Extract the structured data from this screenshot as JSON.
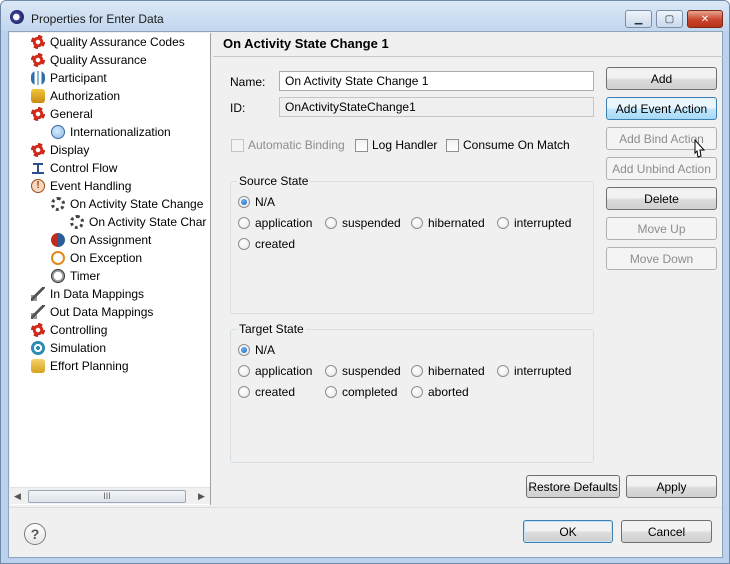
{
  "window": {
    "title": "Properties for Enter Data",
    "minimize_glyph": "▁",
    "maximize_glyph": "▢",
    "close_glyph": "✕"
  },
  "tree": {
    "items": [
      {
        "label": "Quality Assurance Codes",
        "icon": "gear-icon"
      },
      {
        "label": "Quality Assurance",
        "icon": "gear-icon"
      },
      {
        "label": "Participant",
        "icon": "participant-icon"
      },
      {
        "label": "Authorization",
        "icon": "lock-icon"
      },
      {
        "label": "General",
        "icon": "gear-icon"
      },
      {
        "label": "Internationalization",
        "icon": "globe-icon"
      },
      {
        "label": "Display",
        "icon": "gear-icon"
      },
      {
        "label": "Control Flow",
        "icon": "control-flow-icon"
      },
      {
        "label": "Event Handling",
        "icon": "event-warning-icon"
      },
      {
        "label": "On Activity State Change",
        "icon": "cycle-icon"
      },
      {
        "label": "On Activity State Char",
        "icon": "cycle-icon"
      },
      {
        "label": "On Assignment",
        "icon": "assignment-icon"
      },
      {
        "label": "On Exception",
        "icon": "exception-icon"
      },
      {
        "label": "Timer",
        "icon": "timer-icon"
      },
      {
        "label": "In Data Mappings",
        "icon": "data-mapping-icon"
      },
      {
        "label": "Out Data Mappings",
        "icon": "data-mapping-icon"
      },
      {
        "label": "Controlling",
        "icon": "gear-icon"
      },
      {
        "label": "Simulation",
        "icon": "spiral-icon"
      },
      {
        "label": "Effort Planning",
        "icon": "coins-icon"
      }
    ],
    "scroll_left": "◀",
    "scroll_right": "▶",
    "scroll_grip": "III"
  },
  "page": {
    "title": "On Activity State Change 1",
    "name_label": "Name:",
    "name_value": "On Activity State Change 1",
    "id_label": "ID:",
    "id_value": "OnActivityStateChange1",
    "checkboxes": {
      "automatic_binding": "Automatic Binding",
      "log_handler": "Log Handler",
      "consume_on_match": "Consume On Match"
    },
    "source_state": {
      "title": "Source State",
      "options": [
        "N/A",
        "application",
        "suspended",
        "hibernated",
        "interrupted",
        "created"
      ],
      "selected": "N/A"
    },
    "target_state": {
      "title": "Target State",
      "options": [
        "N/A",
        "application",
        "suspended",
        "hibernated",
        "interrupted",
        "created",
        "completed",
        "aborted"
      ],
      "selected": "N/A"
    }
  },
  "actions": {
    "add": "Add",
    "add_event_action": "Add Event Action",
    "add_bind_action": "Add Bind Action",
    "add_unbind_action": "Add Unbind Action",
    "delete": "Delete",
    "move_up": "Move Up",
    "move_down": "Move Down"
  },
  "footer": {
    "restore_defaults": "Restore Defaults",
    "apply": "Apply",
    "ok": "OK",
    "cancel": "Cancel",
    "help_glyph": "?"
  }
}
